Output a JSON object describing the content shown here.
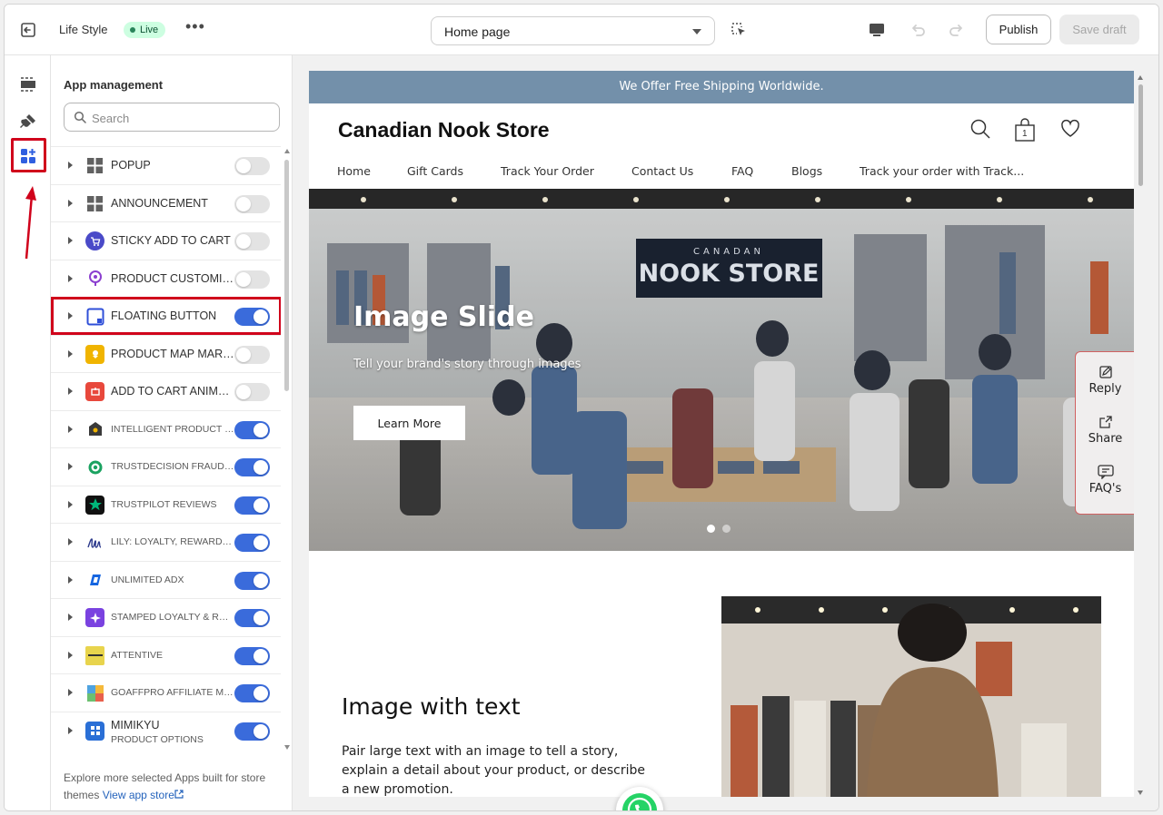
{
  "topbar": {
    "store_name": "Life Style",
    "status_badge": "Live",
    "more_label": "•••",
    "page_select": "Home page",
    "publish_label": "Publish",
    "save_draft_label": "Save draft"
  },
  "panel": {
    "title": "App management",
    "search_placeholder": "Search",
    "apps": [
      {
        "name": "POPUP",
        "enabled": false,
        "icon": "grid-icon",
        "color": "#616161"
      },
      {
        "name": "ANNOUNCEMENT",
        "enabled": false,
        "icon": "grid-icon",
        "color": "#616161"
      },
      {
        "name": "STICKY ADD TO CART",
        "enabled": false,
        "icon": "cart-icon",
        "color": "#4a4ac8"
      },
      {
        "name": "PRODUCT CUSTOMIZER",
        "enabled": false,
        "icon": "paint-icon",
        "color": "#8b3fcf"
      },
      {
        "name": "FLOATING BUTTON",
        "enabled": true,
        "icon": "square-icon",
        "color": "#2f4fd8"
      },
      {
        "name": "PRODUCT MAP MARKER",
        "enabled": false,
        "icon": "map-icon",
        "color": "#f0b400"
      },
      {
        "name": "ADD TO CART ANIMATION",
        "enabled": false,
        "icon": "animation-icon",
        "color": "#e8483c"
      },
      {
        "name": "INTELLIGENT PRODUCT RECOMMENDATIONS",
        "enabled": true,
        "icon": "house-icon",
        "color": "#3a3a3a"
      },
      {
        "name": "TRUSTDECISION FRAUD PREVENTION",
        "enabled": true,
        "icon": "target-icon",
        "color": "#1aa260"
      },
      {
        "name": "TRUSTPILOT REVIEWS",
        "enabled": true,
        "icon": "star-icon",
        "color": "#00b67a"
      },
      {
        "name": "LILY: LOYALTY, REWARDS, REFERRALS",
        "enabled": true,
        "icon": "lily-logo-icon",
        "color": "#2d3a8c"
      },
      {
        "name": "UNLIMITED ADX",
        "enabled": true,
        "icon": "adx-icon",
        "color": "#1565e0"
      },
      {
        "name": "STAMPED LOYALTY & REFERRALS",
        "enabled": true,
        "icon": "stamped-icon",
        "color": "#7a42e0"
      },
      {
        "name": "ATTENTIVE",
        "enabled": true,
        "icon": "attentive-icon",
        "color": "#e8d44d"
      },
      {
        "name": "GOAFFPRO AFFILIATE MARKETING",
        "enabled": true,
        "icon": "puzzle-icon",
        "color": "#4fa3e0"
      },
      {
        "name": "MIMIKYU",
        "sub": "PRODUCT OPTIONS",
        "enabled": true,
        "icon": "options-icon",
        "color": "#2a6fd6"
      }
    ],
    "foot_text": "Explore more selected Apps built for store themes",
    "foot_link": "View app store"
  },
  "preview": {
    "announcement": "We Offer Free Shipping Worldwide.",
    "logo": "Canadian Nook Store",
    "cart_count": "1",
    "nav": [
      "Home",
      "Gift Cards",
      "Track Your Order",
      "Contact Us",
      "FAQ",
      "Blogs",
      "Track your order with Track..."
    ],
    "hero": {
      "sign_top": "CANADAN",
      "sign_main": "NOOK STORE",
      "title": "Image Slide",
      "subtitle": "Tell your brand's story through images",
      "button": "Learn More"
    },
    "floating": [
      "Reply",
      "Share",
      "FAQ's"
    ],
    "image_with_text": {
      "title": "Image with text",
      "body": "Pair large text with an image to tell a story, explain a detail about your product, or describe a new promotion."
    }
  },
  "colors": {
    "accent": "#3a6bdb",
    "highlight": "#d0021b",
    "announcement_bg": "#7390aa"
  }
}
